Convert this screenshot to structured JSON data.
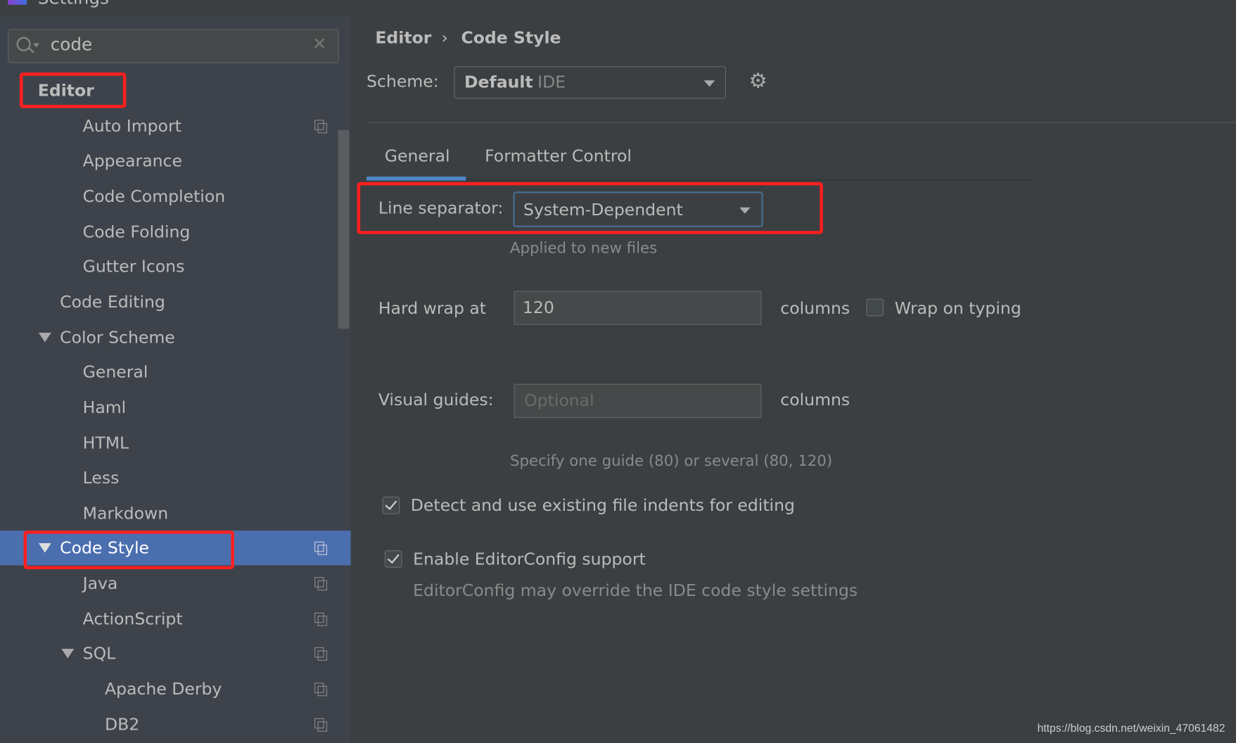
{
  "window": {
    "title": "Settings"
  },
  "search": {
    "value": "code",
    "clear_icon": "close-icon"
  },
  "sidebar": {
    "items": [
      {
        "label": "Editor",
        "level": 0,
        "bold": true,
        "highlighted": true
      },
      {
        "label": "Auto Import",
        "level": 2,
        "project_icon": true
      },
      {
        "label": "Appearance",
        "level": 2
      },
      {
        "label": "Code Completion",
        "level": 2
      },
      {
        "label": "Code Folding",
        "level": 2
      },
      {
        "label": "Gutter Icons",
        "level": 2
      },
      {
        "label": "Code Editing",
        "level": 1
      },
      {
        "label": "Color Scheme",
        "level": 1,
        "expanded": true
      },
      {
        "label": "General",
        "level": 2
      },
      {
        "label": "Haml",
        "level": 2
      },
      {
        "label": "HTML",
        "level": 2
      },
      {
        "label": "Less",
        "level": 2
      },
      {
        "label": "Markdown",
        "level": 2
      },
      {
        "label": "Code Style",
        "level": 1,
        "expanded": true,
        "selected": true,
        "project_icon": true,
        "highlighted": true
      },
      {
        "label": "Java",
        "level": 2,
        "project_icon": true
      },
      {
        "label": "ActionScript",
        "level": 2,
        "project_icon": true
      },
      {
        "label": "SQL",
        "level": 2,
        "expanded": true,
        "project_icon": true
      },
      {
        "label": "Apache Derby",
        "level": 3,
        "project_icon": true
      },
      {
        "label": "DB2",
        "level": 3,
        "project_icon": true
      }
    ]
  },
  "breadcrumb": {
    "parent": "Editor",
    "separator": "›",
    "current": "Code Style"
  },
  "scheme": {
    "label": "Scheme:",
    "name": "Default",
    "type": "IDE"
  },
  "tabs": [
    {
      "label": "General",
      "active": true
    },
    {
      "label": "Formatter Control",
      "active": false
    }
  ],
  "form": {
    "line_separator_label": "Line separator:",
    "line_separator_value": "System-Dependent",
    "line_separator_hint": "Applied to new files",
    "hard_wrap_label": "Hard wrap at",
    "hard_wrap_value": "120",
    "columns_label": "columns",
    "wrap_on_typing_label": "Wrap on typing",
    "wrap_on_typing_checked": false,
    "visual_guides_label": "Visual guides:",
    "visual_guides_placeholder": "Optional",
    "visual_guides_columns": "columns",
    "visual_guides_hint": "Specify one guide (80) or several (80, 120)",
    "detect_indents_label": "Detect and use existing file indents for editing",
    "detect_indents_checked": true,
    "editorconfig_label": "Enable EditorConfig support",
    "editorconfig_checked": true,
    "editorconfig_hint": "EditorConfig may override the IDE code style settings"
  },
  "watermark": "https://blog.csdn.net/weixin_47061482",
  "colors": {
    "selection": "#4b6eaf",
    "highlight_box": "#ff1f1f",
    "tab_underline": "#4a88c7"
  }
}
